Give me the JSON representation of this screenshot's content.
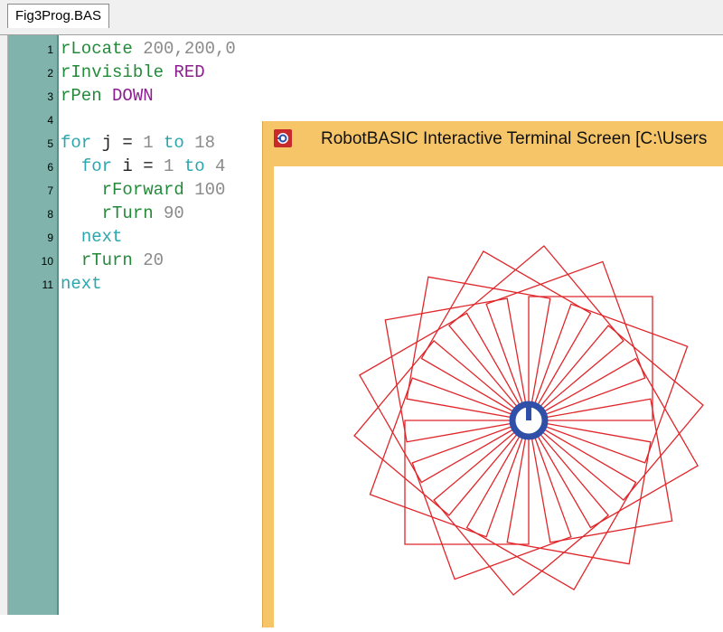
{
  "editor": {
    "tab_label": "Fig3Prog.BAS",
    "lines": [
      {
        "n": "1",
        "indent": 0,
        "tokens": [
          {
            "t": "rLocate ",
            "c": "green"
          },
          {
            "t": "200,200,0",
            "c": "num"
          }
        ]
      },
      {
        "n": "2",
        "indent": 0,
        "tokens": [
          {
            "t": "rInvisible ",
            "c": "green"
          },
          {
            "t": "RED",
            "c": "purple"
          }
        ]
      },
      {
        "n": "3",
        "indent": 0,
        "tokens": [
          {
            "t": "rPen ",
            "c": "green"
          },
          {
            "t": "DOWN",
            "c": "purple"
          }
        ]
      },
      {
        "n": "4",
        "indent": 0,
        "tokens": []
      },
      {
        "n": "5",
        "indent": 0,
        "tokens": [
          {
            "t": "for ",
            "c": "teal"
          },
          {
            "t": "j = ",
            "c": "plain"
          },
          {
            "t": "1",
            "c": "num"
          },
          {
            "t": " to ",
            "c": "teal"
          },
          {
            "t": "18",
            "c": "num"
          }
        ]
      },
      {
        "n": "6",
        "indent": 2,
        "tokens": [
          {
            "t": "for ",
            "c": "teal"
          },
          {
            "t": "i = ",
            "c": "plain"
          },
          {
            "t": "1",
            "c": "num"
          },
          {
            "t": " to ",
            "c": "teal"
          },
          {
            "t": "4",
            "c": "num"
          }
        ]
      },
      {
        "n": "7",
        "indent": 4,
        "tokens": [
          {
            "t": "rForward ",
            "c": "green"
          },
          {
            "t": "100",
            "c": "num"
          }
        ]
      },
      {
        "n": "8",
        "indent": 4,
        "tokens": [
          {
            "t": "rTurn ",
            "c": "green"
          },
          {
            "t": "90",
            "c": "num"
          }
        ]
      },
      {
        "n": "9",
        "indent": 2,
        "tokens": [
          {
            "t": "next",
            "c": "teal"
          }
        ]
      },
      {
        "n": "10",
        "indent": 2,
        "tokens": [
          {
            "t": "rTurn ",
            "c": "green"
          },
          {
            "t": "20",
            "c": "num"
          }
        ]
      },
      {
        "n": "11",
        "indent": 0,
        "tokens": [
          {
            "t": "next",
            "c": "teal"
          }
        ]
      }
    ]
  },
  "terminal": {
    "title": "RobotBASIC Interactive Terminal Screen  [C:\\Users",
    "drawing": {
      "squares": 18,
      "side": 100,
      "rotation_step_deg": 20,
      "line_color": "#e0262a",
      "robot_color": "#2f4fa8"
    }
  },
  "colors": {
    "gutter": "#7fb3ab",
    "terminal_frame": "#f6c568",
    "keyword": "#248a3a",
    "number": "#8a8a8a",
    "constant": "#8b1f8f",
    "loop": "#2aa6ae"
  }
}
